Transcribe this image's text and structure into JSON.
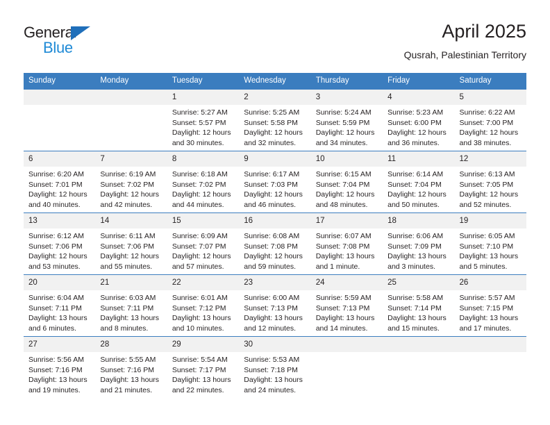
{
  "brand": {
    "name_top": "General",
    "name_bottom": "Blue",
    "accent_blue": "#1f8ad6",
    "triangle_blue": "#1f6fba"
  },
  "header": {
    "title": "April 2025",
    "location": "Qusrah, Palestinian Territory"
  },
  "calendar": {
    "header_bg": "#3b7dbf",
    "daynum_bg": "#f1f1f1",
    "weekday_headers": [
      "Sunday",
      "Monday",
      "Tuesday",
      "Wednesday",
      "Thursday",
      "Friday",
      "Saturday"
    ],
    "weeks": [
      [
        {
          "day": "",
          "lines": []
        },
        {
          "day": "",
          "lines": []
        },
        {
          "day": "1",
          "lines": [
            "Sunrise: 5:27 AM",
            "Sunset: 5:57 PM",
            "Daylight: 12 hours",
            "and 30 minutes."
          ]
        },
        {
          "day": "2",
          "lines": [
            "Sunrise: 5:25 AM",
            "Sunset: 5:58 PM",
            "Daylight: 12 hours",
            "and 32 minutes."
          ]
        },
        {
          "day": "3",
          "lines": [
            "Sunrise: 5:24 AM",
            "Sunset: 5:59 PM",
            "Daylight: 12 hours",
            "and 34 minutes."
          ]
        },
        {
          "day": "4",
          "lines": [
            "Sunrise: 5:23 AM",
            "Sunset: 6:00 PM",
            "Daylight: 12 hours",
            "and 36 minutes."
          ]
        },
        {
          "day": "5",
          "lines": [
            "Sunrise: 6:22 AM",
            "Sunset: 7:00 PM",
            "Daylight: 12 hours",
            "and 38 minutes."
          ]
        }
      ],
      [
        {
          "day": "6",
          "lines": [
            "Sunrise: 6:20 AM",
            "Sunset: 7:01 PM",
            "Daylight: 12 hours",
            "and 40 minutes."
          ]
        },
        {
          "day": "7",
          "lines": [
            "Sunrise: 6:19 AM",
            "Sunset: 7:02 PM",
            "Daylight: 12 hours",
            "and 42 minutes."
          ]
        },
        {
          "day": "8",
          "lines": [
            "Sunrise: 6:18 AM",
            "Sunset: 7:02 PM",
            "Daylight: 12 hours",
            "and 44 minutes."
          ]
        },
        {
          "day": "9",
          "lines": [
            "Sunrise: 6:17 AM",
            "Sunset: 7:03 PM",
            "Daylight: 12 hours",
            "and 46 minutes."
          ]
        },
        {
          "day": "10",
          "lines": [
            "Sunrise: 6:15 AM",
            "Sunset: 7:04 PM",
            "Daylight: 12 hours",
            "and 48 minutes."
          ]
        },
        {
          "day": "11",
          "lines": [
            "Sunrise: 6:14 AM",
            "Sunset: 7:04 PM",
            "Daylight: 12 hours",
            "and 50 minutes."
          ]
        },
        {
          "day": "12",
          "lines": [
            "Sunrise: 6:13 AM",
            "Sunset: 7:05 PM",
            "Daylight: 12 hours",
            "and 52 minutes."
          ]
        }
      ],
      [
        {
          "day": "13",
          "lines": [
            "Sunrise: 6:12 AM",
            "Sunset: 7:06 PM",
            "Daylight: 12 hours",
            "and 53 minutes."
          ]
        },
        {
          "day": "14",
          "lines": [
            "Sunrise: 6:11 AM",
            "Sunset: 7:06 PM",
            "Daylight: 12 hours",
            "and 55 minutes."
          ]
        },
        {
          "day": "15",
          "lines": [
            "Sunrise: 6:09 AM",
            "Sunset: 7:07 PM",
            "Daylight: 12 hours",
            "and 57 minutes."
          ]
        },
        {
          "day": "16",
          "lines": [
            "Sunrise: 6:08 AM",
            "Sunset: 7:08 PM",
            "Daylight: 12 hours",
            "and 59 minutes."
          ]
        },
        {
          "day": "17",
          "lines": [
            "Sunrise: 6:07 AM",
            "Sunset: 7:08 PM",
            "Daylight: 13 hours",
            "and 1 minute."
          ]
        },
        {
          "day": "18",
          "lines": [
            "Sunrise: 6:06 AM",
            "Sunset: 7:09 PM",
            "Daylight: 13 hours",
            "and 3 minutes."
          ]
        },
        {
          "day": "19",
          "lines": [
            "Sunrise: 6:05 AM",
            "Sunset: 7:10 PM",
            "Daylight: 13 hours",
            "and 5 minutes."
          ]
        }
      ],
      [
        {
          "day": "20",
          "lines": [
            "Sunrise: 6:04 AM",
            "Sunset: 7:11 PM",
            "Daylight: 13 hours",
            "and 6 minutes."
          ]
        },
        {
          "day": "21",
          "lines": [
            "Sunrise: 6:03 AM",
            "Sunset: 7:11 PM",
            "Daylight: 13 hours",
            "and 8 minutes."
          ]
        },
        {
          "day": "22",
          "lines": [
            "Sunrise: 6:01 AM",
            "Sunset: 7:12 PM",
            "Daylight: 13 hours",
            "and 10 minutes."
          ]
        },
        {
          "day": "23",
          "lines": [
            "Sunrise: 6:00 AM",
            "Sunset: 7:13 PM",
            "Daylight: 13 hours",
            "and 12 minutes."
          ]
        },
        {
          "day": "24",
          "lines": [
            "Sunrise: 5:59 AM",
            "Sunset: 7:13 PM",
            "Daylight: 13 hours",
            "and 14 minutes."
          ]
        },
        {
          "day": "25",
          "lines": [
            "Sunrise: 5:58 AM",
            "Sunset: 7:14 PM",
            "Daylight: 13 hours",
            "and 15 minutes."
          ]
        },
        {
          "day": "26",
          "lines": [
            "Sunrise: 5:57 AM",
            "Sunset: 7:15 PM",
            "Daylight: 13 hours",
            "and 17 minutes."
          ]
        }
      ],
      [
        {
          "day": "27",
          "lines": [
            "Sunrise: 5:56 AM",
            "Sunset: 7:16 PM",
            "Daylight: 13 hours",
            "and 19 minutes."
          ]
        },
        {
          "day": "28",
          "lines": [
            "Sunrise: 5:55 AM",
            "Sunset: 7:16 PM",
            "Daylight: 13 hours",
            "and 21 minutes."
          ]
        },
        {
          "day": "29",
          "lines": [
            "Sunrise: 5:54 AM",
            "Sunset: 7:17 PM",
            "Daylight: 13 hours",
            "and 22 minutes."
          ]
        },
        {
          "day": "30",
          "lines": [
            "Sunrise: 5:53 AM",
            "Sunset: 7:18 PM",
            "Daylight: 13 hours",
            "and 24 minutes."
          ]
        },
        {
          "day": "",
          "lines": []
        },
        {
          "day": "",
          "lines": []
        },
        {
          "day": "",
          "lines": []
        }
      ]
    ]
  }
}
